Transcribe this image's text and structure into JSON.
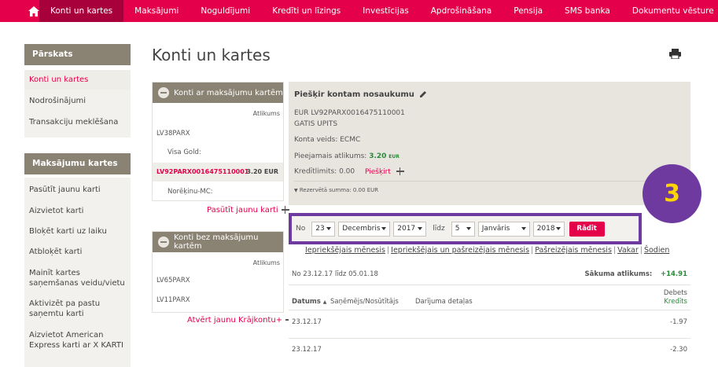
{
  "nav": {
    "items": [
      "Konti un kartes",
      "Maksājumi",
      "Noguldījumi",
      "Kredīti un līzings",
      "Investīcijas",
      "Apdrošināšana",
      "Pensija",
      "SMS banka",
      "Dokumentu vēsture"
    ],
    "active": 0,
    "color": "#e5004b"
  },
  "sidebar": {
    "overview_title": "Pārskats",
    "overview_items": [
      "Konti un kartes",
      "Nodrošinājumi",
      "Transakciju meklēšana"
    ],
    "cards_title": "Maksājumu kartes",
    "cards_items": [
      "Pasūtīt jaunu karti",
      "Aizvietot karti",
      "Bloķēt karti uz laiku",
      "Atbloķēt karti",
      "Mainīt kartes saņemšanas veidu/vietu",
      "Aktivizēt pa pastu saņemtu karti",
      "Aizvietot American Express karti ar X KARTI"
    ]
  },
  "page_title": "Konti un kartes",
  "accounts_with_cards": {
    "title": "Konti ar maksājumu kartēm",
    "balance_header": "Atlikums",
    "rows": [
      "LV38PARX",
      "Visa Gold:",
      "LV92PARX0016475110001",
      "Norēķinu-MC:"
    ],
    "selected_amount": "3.20 EUR",
    "link": "Pasūtīt jaunu karti"
  },
  "accounts_without_cards": {
    "title": "Konti bez maksājumu kartēm",
    "balance_header": "Atlikums",
    "rows": [
      "LV65PARX",
      "LV11PARX"
    ],
    "link": "Atvērt jaunu Krājkontu+"
  },
  "detail": {
    "name_label": "Piešķir kontam nosaukumu",
    "account": "EUR LV92PARX0016475110001",
    "holder": "GATIS UPITS",
    "type": "Konta veids: ECMC",
    "available_label": "Pieejamais atlikums:",
    "available_value": "3.20",
    "available_currency": "EUR",
    "limit_label": "Kredītlimits: 0.00",
    "grant_link": "Piešķirt",
    "reserved": "Rezervētā summa: 0.00 EUR"
  },
  "filter": {
    "from_label": "No",
    "from_day": "23",
    "from_month": "Decembris",
    "from_year": "2017",
    "until_label": "līdz",
    "to_day": "5",
    "to_month": "Janvāris",
    "to_year": "2018",
    "button": "Rādīt"
  },
  "badge": "3",
  "periods": [
    "Iepriekšējais mēnesis",
    "Iepriekšējais un pašreizējais mēnesis",
    "Pašreizējais mēnesis",
    "Vakar",
    "Šodien"
  ],
  "table": {
    "range": "No 23.12.17 līdz 05.01.18",
    "start_balance_label": "Sākuma atlikums:",
    "start_balance_value": "+14.91",
    "col_date": "Datums",
    "col_party": "Saņēmējs/Nosūtītājs",
    "col_details": "Darījuma detaļas",
    "col_debit": "Debets",
    "col_credit": "Kredīts",
    "rows": [
      {
        "date": "23.12.17",
        "amount": "-1.97"
      },
      {
        "date": "23.12.17",
        "amount": "-2.30"
      }
    ]
  }
}
